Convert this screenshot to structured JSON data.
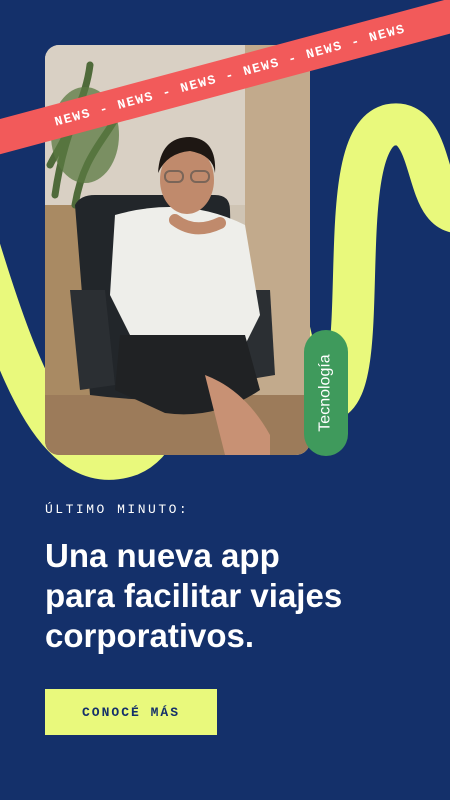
{
  "banner": {
    "text": "NEWS - NEWS - NEWS - NEWS - NEWS - NEWS"
  },
  "tag": {
    "label": "Tecnología"
  },
  "article": {
    "kicker": "ÚLTIMO MINUTO:",
    "headline_lines": [
      "Una nueva app",
      "para facilitar viajes",
      "corporativos."
    ]
  },
  "cta": {
    "label": "CONOCÉ MÁS"
  },
  "colors": {
    "background": "#14306a",
    "accent_yellow": "#e9f97c",
    "banner_red": "#f25a5a",
    "tag_green": "#3f9a5c"
  }
}
